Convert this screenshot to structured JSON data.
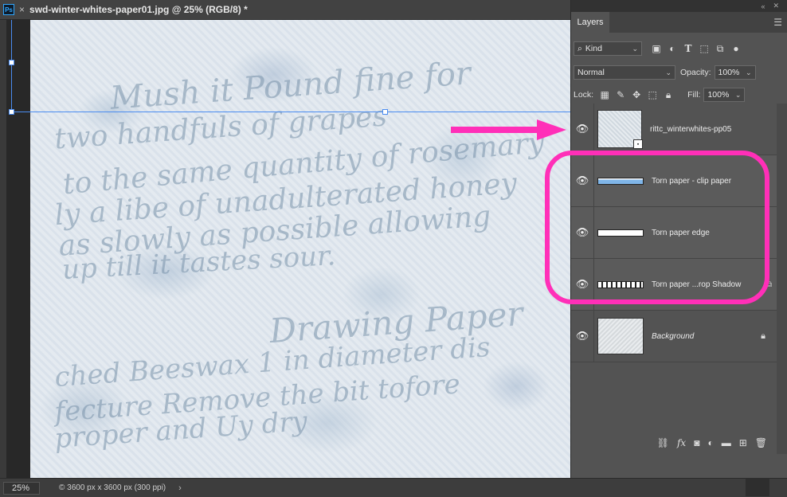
{
  "document": {
    "tab_title": "swd-winter-whites-paper01.jpg @ 25% (RGB/8) *",
    "close_symbol": "×",
    "app_badge": "Ps"
  },
  "canvas": {
    "script_lines": [
      "Mush it Pound fine for",
      "two handfuls of grapes",
      "to the same quantity of rosemary",
      "ly a libe of unadulterated honey",
      "as slowly as possible allowing",
      "up till it tastes sour.",
      "Drawing Paper",
      "ched Beeswax 1 in diameter dis",
      "fecture Remove the bit tofore",
      "proper and Uy dry"
    ]
  },
  "status": {
    "zoom": "25%",
    "doc_info": "© 3600 px x 3600 px (300 ppi)",
    "chevron": "›"
  },
  "panel": {
    "collapse": "«",
    "close": "✕",
    "tab": "Layers",
    "filter_kind": "Kind",
    "blend_mode": "Normal",
    "opacity_label": "Opacity:",
    "opacity_value": "100%",
    "lock_label": "Lock:",
    "fill_label": "Fill:",
    "fill_value": "100%",
    "layers": [
      {
        "name": "rittc_winterwhites-pp05",
        "visible": true
      },
      {
        "name": "Torn paper - clip paper",
        "visible": true
      },
      {
        "name": "Torn paper edge",
        "visible": true
      },
      {
        "name": "Torn paper ...rop Shadow",
        "visible": true
      },
      {
        "name": "Background",
        "visible": true,
        "locked": true
      }
    ]
  },
  "annotation": {
    "color": "#ff2fb8"
  }
}
